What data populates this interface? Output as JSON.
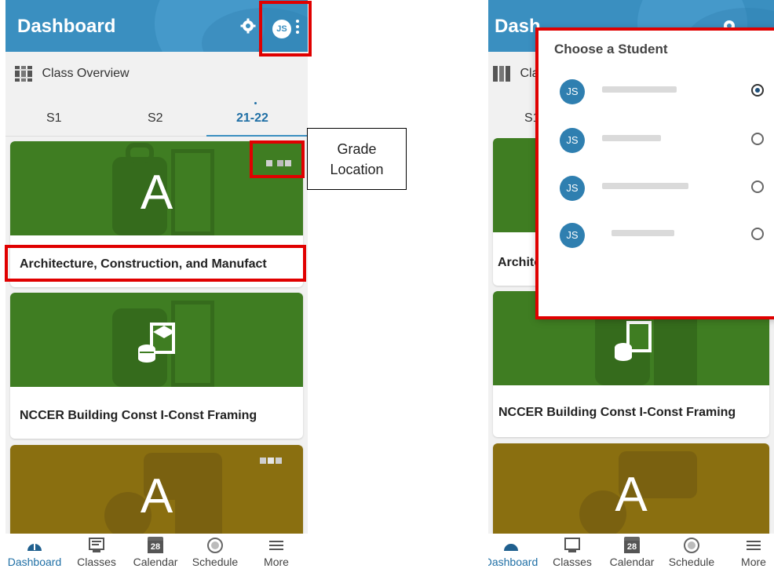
{
  "app": {
    "title": "Dashboard",
    "avatar_initials": "JS",
    "accent": "#3a8fc0"
  },
  "overview": {
    "label": "Class Overview"
  },
  "tabs": [
    {
      "label": "S1",
      "active": false
    },
    {
      "label": "S2",
      "active": false
    },
    {
      "label": "21-22",
      "active": true
    }
  ],
  "classes": [
    {
      "grade": "A",
      "title": "Architecture, Construction, and Manufact",
      "color": "#3f7d22",
      "icon": "book-bag-icon"
    },
    {
      "grade": "",
      "title": "NCCER Building Const I-Const Framing",
      "color": "#3f7d22",
      "icon": "graduation-books-icon"
    },
    {
      "grade": "A",
      "title": "",
      "color": "#8a6f10",
      "icon": "apple-chat-icon"
    }
  ],
  "nav": [
    {
      "label": "Dashboard",
      "icon": "dashboard-icon",
      "active": true
    },
    {
      "label": "Classes",
      "icon": "classes-icon",
      "active": false
    },
    {
      "label": "Calendar",
      "icon": "calendar-icon",
      "active": false,
      "day": "28"
    },
    {
      "label": "Schedule",
      "icon": "schedule-icon",
      "active": false
    },
    {
      "label": "More",
      "icon": "menu-icon",
      "active": false
    }
  ],
  "annotation": {
    "callout": "Grade Location",
    "callout_line1": "Grade",
    "callout_line2": "Location",
    "highlight_color": "#e00000"
  },
  "student_picker": {
    "title": "Choose a Student",
    "students": [
      {
        "initials": "JS",
        "selected": true
      },
      {
        "initials": "JS",
        "selected": false
      },
      {
        "initials": "JS",
        "selected": false
      },
      {
        "initials": "JS",
        "selected": false
      }
    ]
  },
  "right_partial": {
    "title_visible": "Dash",
    "overview_visible": "Cla",
    "tab_visible": "S1",
    "card1_title_visible": "Archite",
    "card2_title": "NCCER Building Const I-Const Framing"
  }
}
